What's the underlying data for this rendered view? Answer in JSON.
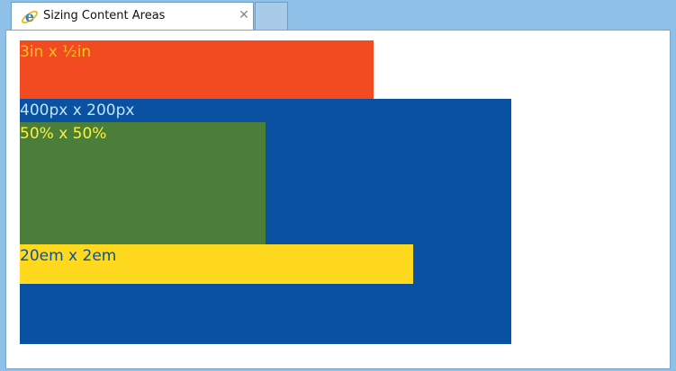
{
  "browser": {
    "tab_title": "Sizing Content Areas",
    "tab_close_glyph": "✕",
    "favicon": "internet-explorer-icon"
  },
  "content": {
    "box_3in_label": "3in x ½in",
    "box_400px_label": "400px x 200px",
    "box_50pct_label": "50% x 50%",
    "box_20em_label": "20em x 2em"
  },
  "colors": {
    "chrome": "#8ec0e8",
    "box_3in_bg": "#f24b21",
    "box_3in_text": "#ffc021",
    "box_400px_bg": "#0a51a1",
    "box_400px_text": "#bde6f7",
    "box_50pct_bg": "#4b7f39",
    "box_50pct_text": "#ffef3d",
    "box_20em_bg": "#ffd91d",
    "box_20em_text": "#0a51a1"
  }
}
